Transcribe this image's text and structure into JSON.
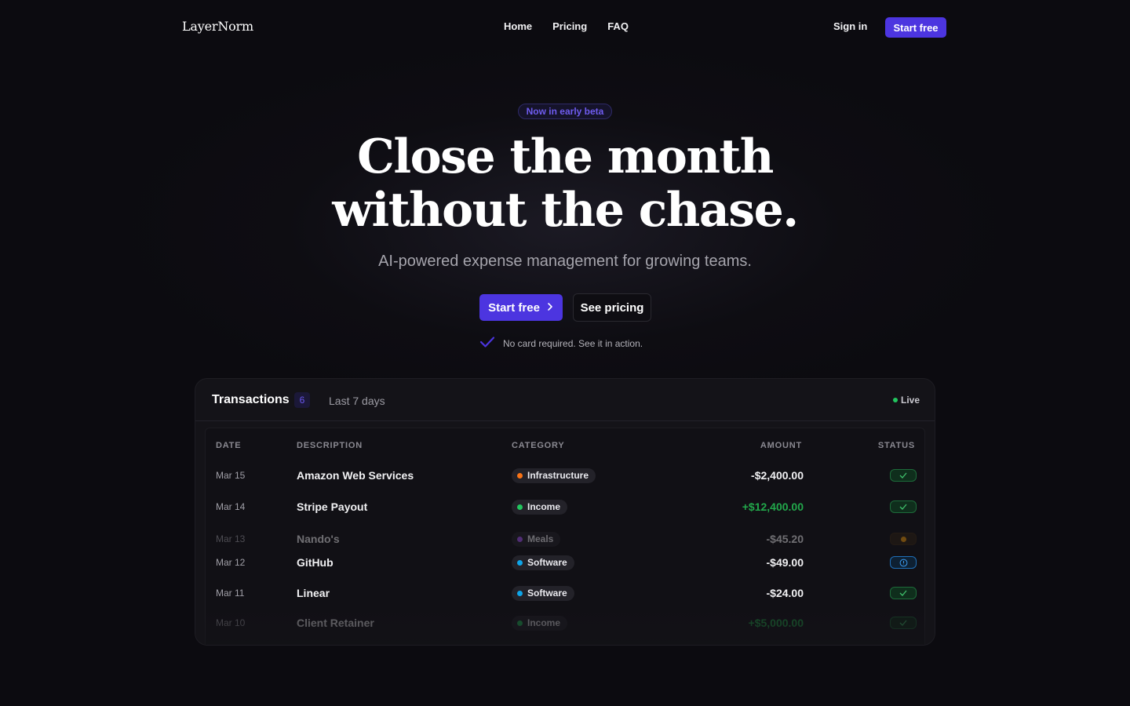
{
  "nav": {
    "logo": "LayerNorm",
    "links": [
      "Home",
      "Pricing",
      "FAQ"
    ],
    "sign_in": "Sign in",
    "cta": "Start free"
  },
  "hero": {
    "badge": "Now in early beta",
    "headline_line1": "Close the month",
    "headline_line2": "without the chase.",
    "subhead": "AI-powered expense management for growing teams.",
    "primary_cta": "Start free",
    "secondary_cta": "See pricing",
    "note": "No card required. See it in action."
  },
  "colors": {
    "accent": "#4c35e0",
    "positive": "#22a84b",
    "live": "#22c55e"
  },
  "transactions": {
    "title": "Transactions",
    "count": "6",
    "range": "Last 7 days",
    "live_label": "Live",
    "columns": [
      "DATE",
      "DESCRIPTION",
      "CATEGORY",
      "AMOUNT",
      "STATUS"
    ],
    "rows": [
      {
        "date": "Mar 15",
        "description": "Amazon Web Services",
        "category": "Infrastructure",
        "category_color": "#f97316",
        "amount": "-$2,400.00",
        "positive": false,
        "status": "check-icon"
      },
      {
        "date": "Mar 14",
        "description": "Stripe Payout",
        "category": "Income",
        "category_color": "#22c55e",
        "amount": "+$12,400.00",
        "positive": true,
        "status": "check-icon"
      },
      {
        "date": "Mar 13",
        "description": "Nando's",
        "category": "Meals",
        "category_color": "#a855f7",
        "amount": "-$45.20",
        "positive": false,
        "status": "pending-dot-icon"
      },
      {
        "date": "Mar 12",
        "description": "GitHub",
        "category": "Software",
        "category_color": "#0ea5e9",
        "amount": "-$49.00",
        "positive": false,
        "status": "info-icon"
      },
      {
        "date": "Mar 11",
        "description": "Linear",
        "category": "Software",
        "category_color": "#0ea5e9",
        "amount": "-$24.00",
        "positive": false,
        "status": "check-icon"
      },
      {
        "date": "Mar 10",
        "description": "Client Retainer",
        "category": "Income",
        "category_color": "#22c55e",
        "amount": "+$5,000.00",
        "positive": true,
        "status": "check-icon"
      }
    ]
  }
}
